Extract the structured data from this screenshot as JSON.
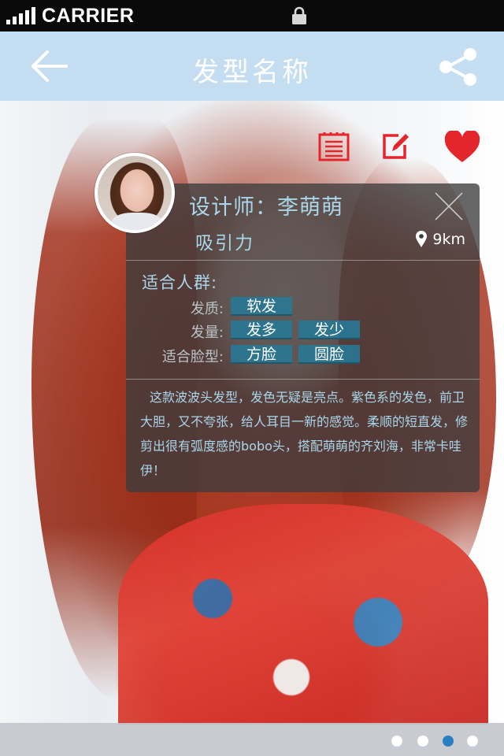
{
  "status_bar": {
    "carrier": "CARRIER"
  },
  "nav": {
    "title": "发型名称"
  },
  "actions": {
    "note_icon": "notepad-icon",
    "edit_icon": "edit-icon",
    "favorite_icon": "heart-icon"
  },
  "card": {
    "designer": "设计师：李萌萌",
    "subtitle": "吸引力",
    "distance": "9km",
    "section_title": "适合人群:",
    "rows": [
      {
        "label": "发质:",
        "tags": [
          "软发"
        ]
      },
      {
        "label": "发量:",
        "tags": [
          "发多",
          "发少"
        ]
      },
      {
        "label": "适合脸型:",
        "tags": [
          "方脸",
          "圆脸"
        ]
      }
    ],
    "description": "这款波波头发型，发色无疑是亮点。紫色系的发色，前卫大胆，又不夸张，给人耳目一新的感觉。柔顺的短直发，修剪出很有弧度感的bobo头，搭配萌萌的齐刘海，非常卡哇伊！"
  },
  "pagination": {
    "total": 4,
    "active": 3
  },
  "colors": {
    "nav_bg": "#c1dcf0",
    "accent_text": "#a9d6ea",
    "tag_bg": "#28789a",
    "heart": "#e4252c",
    "active_dot": "#2a7fc0"
  }
}
